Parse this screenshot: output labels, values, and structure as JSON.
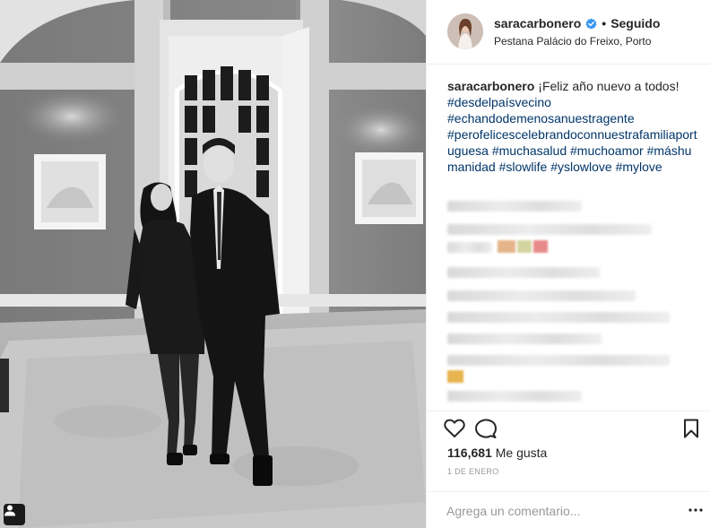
{
  "header": {
    "username": "saracarbonero",
    "verified": true,
    "separator": "•",
    "follow_state": "Seguido",
    "location": "Pestana Palácio do Freixo, Porto"
  },
  "caption": {
    "username": "saracarbonero",
    "text": "¡Feliz año nuevo a todos!",
    "hashtags": [
      "#desdelpaísvecino",
      "#echandodemenosanuestragente",
      "#perofelicescelebrandoconnuestrafamiliaportuguesa",
      "#muchasalud",
      "#muchoamor",
      "#máshumanidad",
      "#slowlife",
      "#yslowlove",
      "#mylove"
    ]
  },
  "likes": {
    "count": "116,681",
    "label": "Me gusta"
  },
  "date": "1 DE ENERO",
  "comment": {
    "placeholder": "Agrega un comentario..."
  },
  "icons": {
    "like": "heart-outline-icon",
    "comment": "speech-bubble-icon",
    "save": "bookmark-icon",
    "more": "more-options-icon",
    "verified": "verified-badge-icon",
    "tag": "user-tag-icon"
  },
  "colors": {
    "hashtag": "#003569",
    "verified": "#3897f0",
    "muted": "#999999",
    "text": "#262626"
  }
}
